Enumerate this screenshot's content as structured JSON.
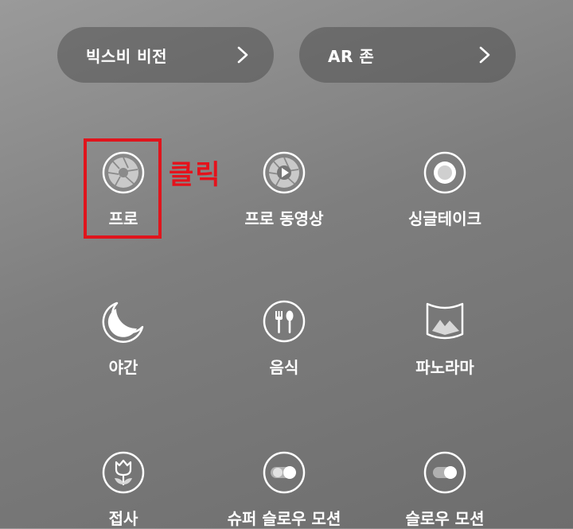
{
  "top_buttons": [
    {
      "label": "빅스비 비전",
      "icon": "chevron-right-icon"
    },
    {
      "label": "AR 존",
      "icon": "chevron-right-icon"
    }
  ],
  "modes": [
    {
      "label": "프로",
      "icon": "aperture-icon"
    },
    {
      "label": "프로 동영상",
      "icon": "aperture-play-icon"
    },
    {
      "label": "싱글테이크",
      "icon": "single-take-icon"
    },
    {
      "label": "야간",
      "icon": "moon-icon"
    },
    {
      "label": "음식",
      "icon": "fork-spoon-icon"
    },
    {
      "label": "파노라마",
      "icon": "panorama-icon"
    },
    {
      "label": "접사",
      "icon": "tulip-icon"
    },
    {
      "label": "슈퍼 슬로우 모션",
      "icon": "super-slow-toggle-icon"
    },
    {
      "label": "슬로우 모션",
      "icon": "slow-toggle-icon"
    }
  ],
  "annotation": {
    "text": "클릭",
    "color": "#e5121b"
  },
  "colors": {
    "highlight": "#e0141c",
    "pill_bg": "rgba(80,80,80,0.55)",
    "text": "#ffffff"
  }
}
